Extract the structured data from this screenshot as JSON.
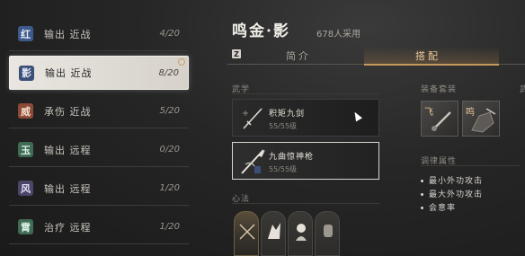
{
  "roles": [
    {
      "badge": "红",
      "badge_bg": "#3d5a8a",
      "badge_fg": "#e6ecf5",
      "label": "输出 近战",
      "count": "4/20",
      "active": false
    },
    {
      "badge": "影",
      "badge_bg": "#3b4f7a",
      "badge_fg": "#e6ecf5",
      "label": "输出 近战",
      "count": "8/20",
      "active": true
    },
    {
      "badge": "威",
      "badge_bg": "#8a4a36",
      "badge_fg": "#f2d9c8",
      "label": "承伤 近战",
      "count": "5/20",
      "active": false
    },
    {
      "badge": "玉",
      "badge_bg": "#3f6b55",
      "badge_fg": "#dcefe4",
      "label": "输出 远程",
      "count": "0/20",
      "active": false
    },
    {
      "badge": "风",
      "badge_bg": "#4a4668",
      "badge_fg": "#e2def2",
      "label": "输出 远程",
      "count": "1/20",
      "active": false
    },
    {
      "badge": "霄",
      "badge_bg": "#3f6b55",
      "badge_fg": "#dcefe4",
      "label": "治疗 远程",
      "count": "1/20",
      "active": false
    }
  ],
  "header": {
    "title": "鸣金·影",
    "count": "678人采用"
  },
  "tabs": {
    "key": "Z",
    "intro": "简介",
    "build": "搭配"
  },
  "sections": {
    "martial": "武学",
    "gear": "装备套装",
    "attrs": "调律属性",
    "heart": "心法",
    "extra": "武"
  },
  "skills": [
    {
      "name": "积矩九剑",
      "level": "55/55级",
      "selected": false
    },
    {
      "name": "九曲惊神枪",
      "level": "55/55级",
      "selected": true
    }
  ],
  "gear": [
    {
      "glyph": "飞"
    },
    {
      "glyph": "鸣"
    }
  ],
  "attrs": [
    "最小外功攻击",
    "最大外功攻击",
    "会意率"
  ],
  "colors": {
    "accent": "#c59a5e",
    "accent_text": "#e9c89a"
  }
}
